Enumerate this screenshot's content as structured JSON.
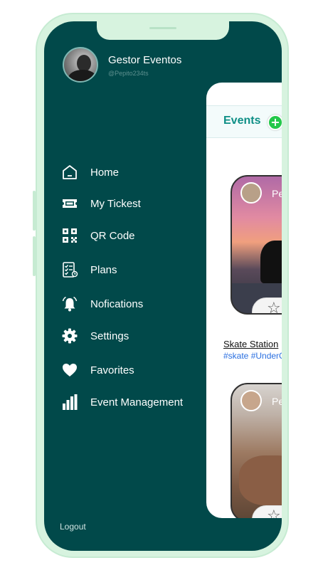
{
  "profile": {
    "name": "Gestor Eventos",
    "handle": "@Pepito234ts"
  },
  "menu": {
    "items": [
      {
        "label": "Home",
        "icon": "home-icon"
      },
      {
        "label": "My Tickest",
        "icon": "ticket-icon"
      },
      {
        "label": "QR Code",
        "icon": "qr-code-icon"
      },
      {
        "label": "Plans",
        "icon": "checklist-icon"
      },
      {
        "label": "Nofications",
        "icon": "alarm-bell-icon"
      },
      {
        "label": "Settings",
        "icon": "gear-icon"
      },
      {
        "label": "Favorites",
        "icon": "heart-icon"
      },
      {
        "label": "Event Management",
        "icon": "bar-chart-icon"
      }
    ],
    "logout_label": "Logout"
  },
  "events": {
    "title": "Events",
    "add_symbol": "+",
    "cards": [
      {
        "owner": "Pe",
        "name": "Skate Station",
        "tags": "#skate #UnderG"
      },
      {
        "owner": "Pe"
      }
    ],
    "fav_symbol": "☆"
  },
  "colors": {
    "drawer_bg": "#01494a",
    "phone_frame": "#d7f3df",
    "accent": "#0e8f86",
    "add_button": "#23c84a",
    "tag_link": "#2a6fe0"
  }
}
